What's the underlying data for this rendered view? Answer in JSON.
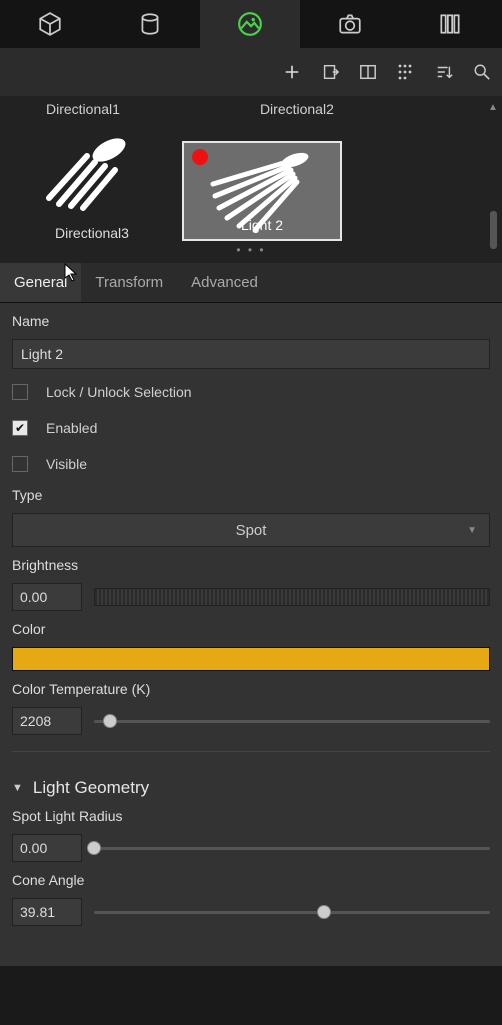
{
  "main_tabs": {
    "geometry": "cube-icon",
    "materials": "cylinder-icon",
    "environment": "landscape-icon",
    "camera": "camera-icon",
    "render": "columns-icon",
    "active": "environment"
  },
  "toolbar": {
    "add": "plus-icon",
    "duplicate": "page-out-icon",
    "split_view": "split-icon",
    "list_view": "grid-dots-icon",
    "sort": "sort-icon",
    "search": "search-icon"
  },
  "gallery": {
    "top_row": [
      {
        "label": "Directional1"
      },
      {
        "label": "Directional2"
      }
    ],
    "items": [
      {
        "label": "Directional3",
        "selected": false,
        "kind": "directional"
      },
      {
        "label": "Light 2",
        "selected": true,
        "kind": "spot",
        "recording": true
      }
    ]
  },
  "prop_tabs": {
    "general": "General",
    "transform": "Transform",
    "advanced": "Advanced",
    "active": "general"
  },
  "fields": {
    "name_label": "Name",
    "name_value": "Light 2",
    "lock_label": "Lock / Unlock Selection",
    "lock_checked": false,
    "enabled_label": "Enabled",
    "enabled_checked": true,
    "visible_label": "Visible",
    "visible_checked": false,
    "type_label": "Type",
    "type_value": "Spot",
    "brightness_label": "Brightness",
    "brightness_value": "0.00",
    "color_label": "Color",
    "color_value": "#e6a813",
    "color_temp_label": "Color Temperature (K)",
    "color_temp_value": "2208",
    "color_temp_pos": 4,
    "geometry_section": "Light Geometry",
    "spot_radius_label": "Spot Light Radius",
    "spot_radius_value": "0.00",
    "spot_radius_pos": 0,
    "cone_angle_label": "Cone Angle",
    "cone_angle_value": "39.81",
    "cone_angle_pos": 58
  }
}
